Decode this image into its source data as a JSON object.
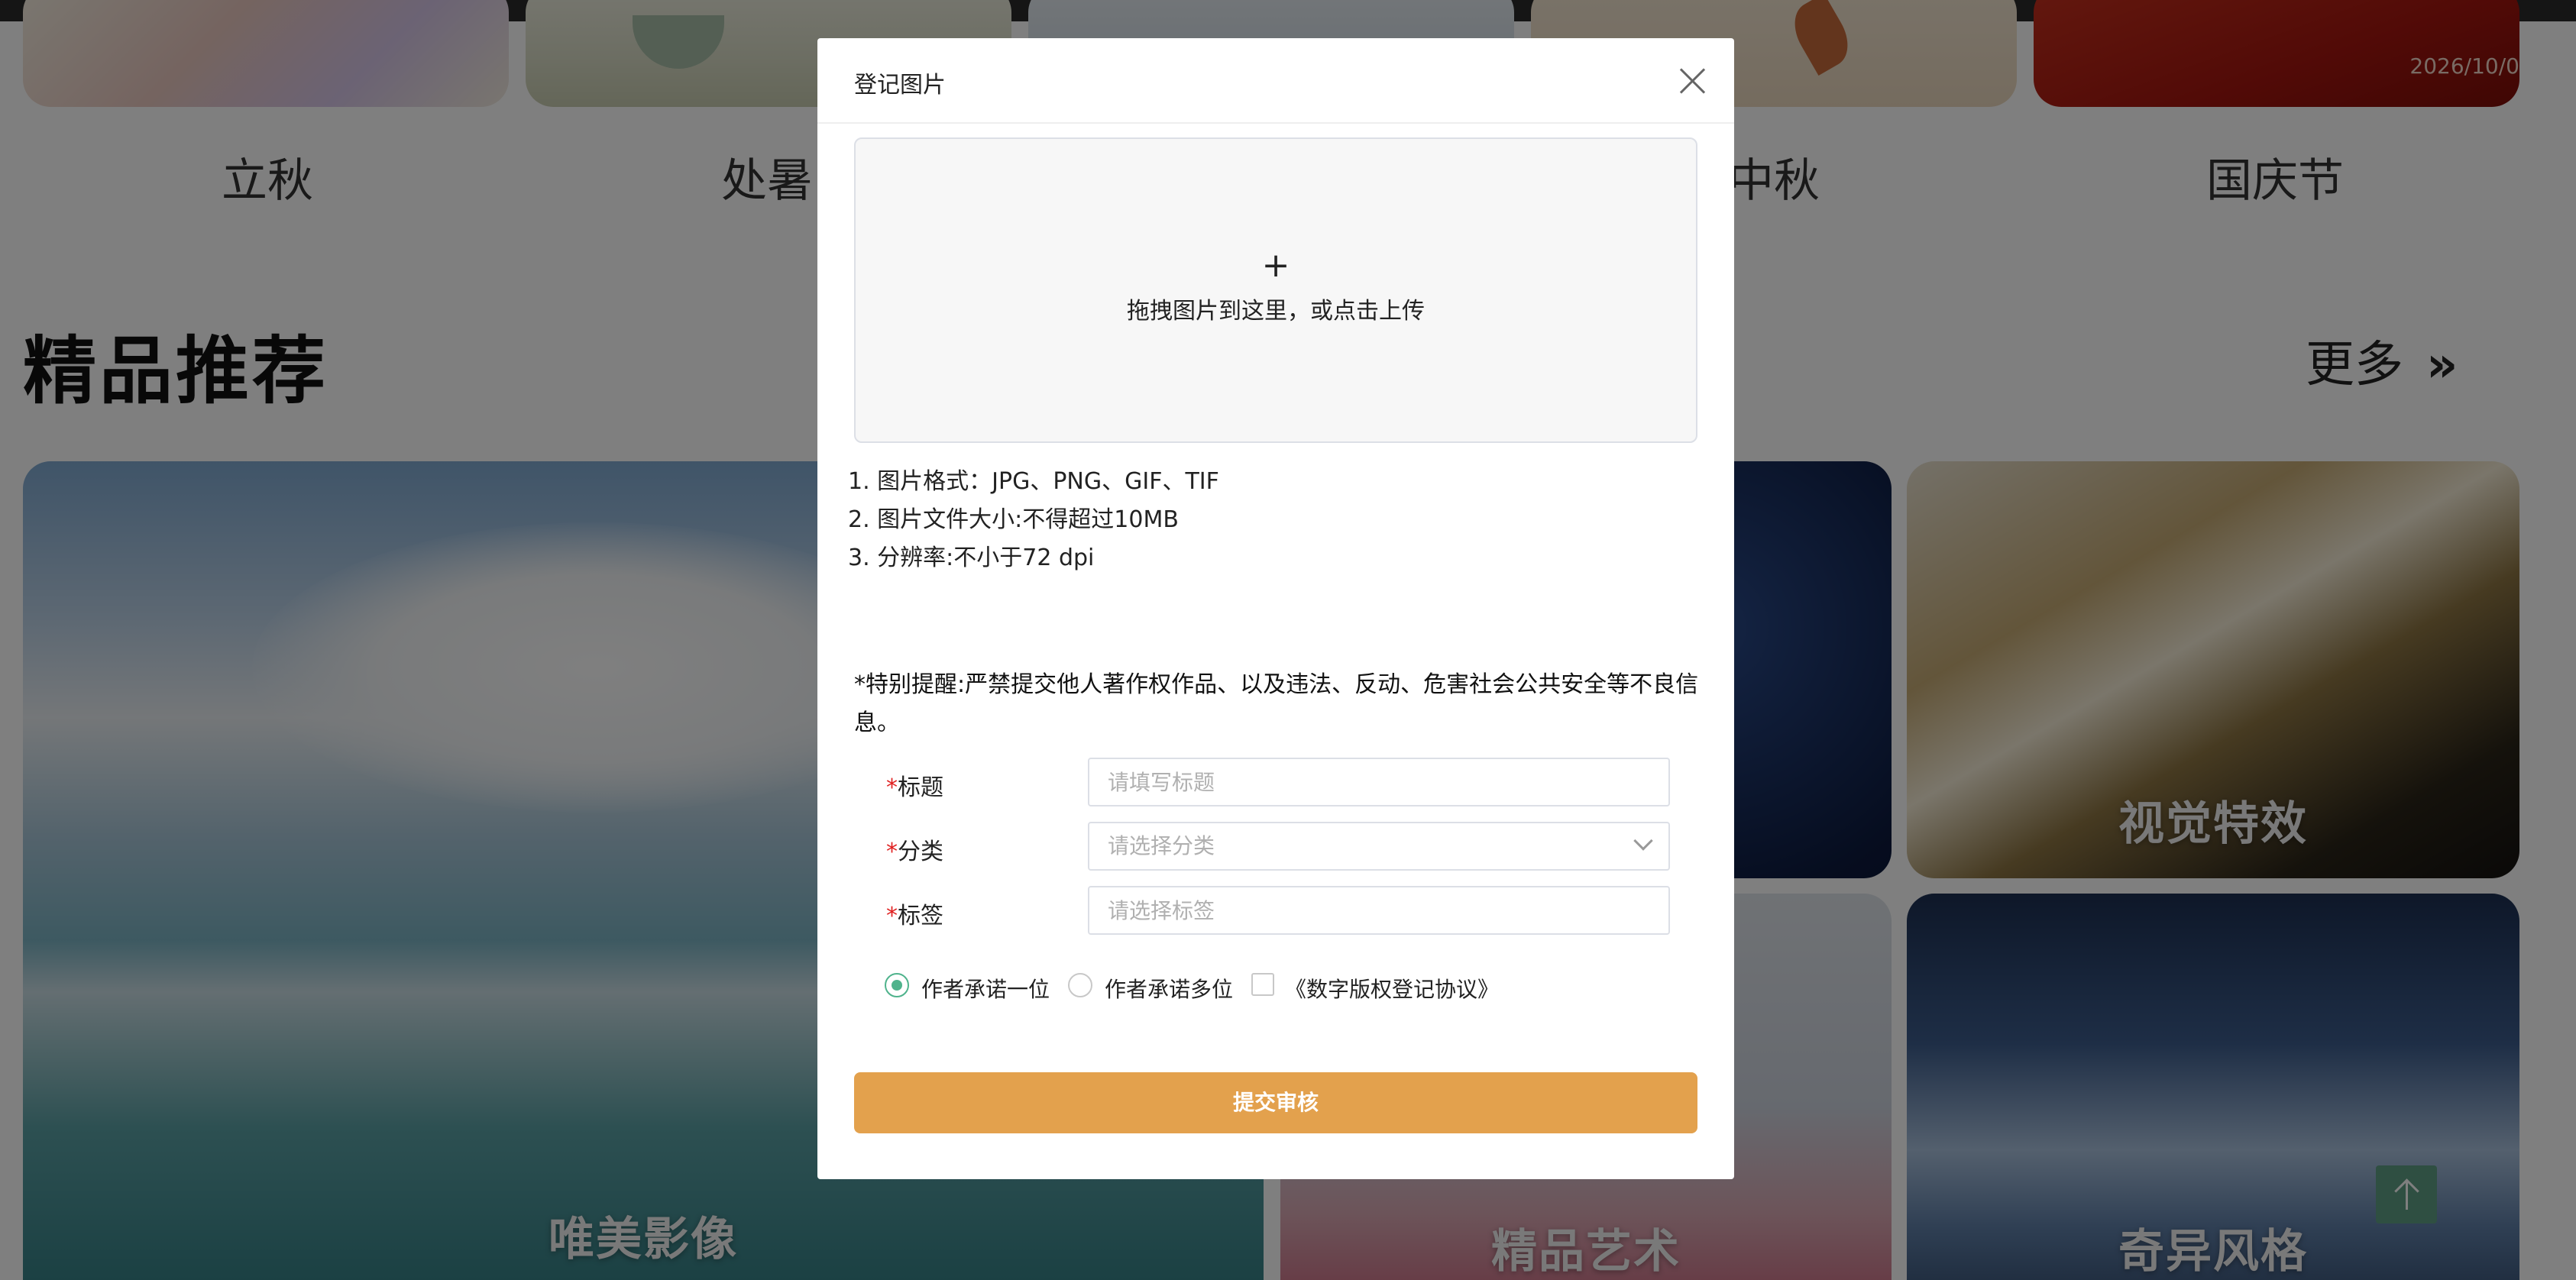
{
  "festivals": [
    {
      "label": "立秋"
    },
    {
      "label": "处暑"
    },
    {
      "label": "中秋"
    },
    {
      "label": "国庆节"
    }
  ],
  "festival_date": "2026/10/0",
  "section": {
    "title": "精品推荐",
    "more": "更多",
    "more_arrow": "»"
  },
  "cards": [
    {
      "label": "唯美影像"
    },
    {
      "label": "视觉特效"
    },
    {
      "label": "精品艺术"
    },
    {
      "label": "奇异风格"
    }
  ],
  "modal": {
    "title": "登记图片",
    "upload": {
      "plus": "+",
      "hint": "拖拽图片到这里，或点击上传"
    },
    "requirements": [
      "1. 图片格式：JPG、PNG、GIF、TIF",
      "2. 图片文件大小:不得超过10MB",
      "3. 分辨率:不小于72 dpi"
    ],
    "warning": "*特别提醒:严禁提交他人著作权作品、以及违法、反动、危害社会公共安全等不良信息。",
    "fields": {
      "required_mark": "*",
      "title_label": "标题",
      "title_placeholder": "请填写标题",
      "category_label": "分类",
      "category_placeholder": "请选择分类",
      "tags_label": "标签",
      "tags_placeholder": "请选择标签"
    },
    "options": {
      "single_author": "作者承诺一位",
      "multi_author": "作者承诺多位",
      "agreement": "《数字版权登记协议》"
    },
    "submit": "提交审核"
  },
  "colors": {
    "accent_orange": "#e3a14d",
    "radio_green": "#4fb38c",
    "scroll_top": "#5f9e84"
  }
}
